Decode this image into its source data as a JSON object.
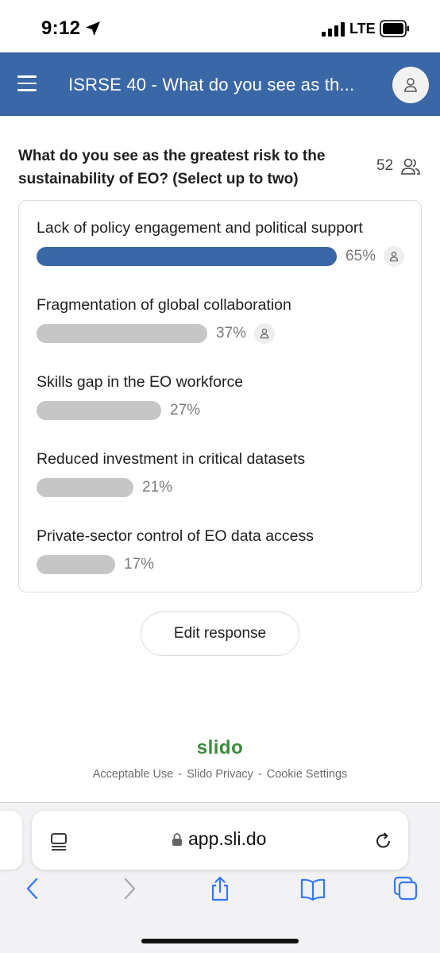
{
  "status_bar": {
    "time": "9:12",
    "network": "LTE"
  },
  "header": {
    "title": "ISRSE 40 - What do you see as th..."
  },
  "question": {
    "text": "What do you see as the greatest risk to the sustainability of EO? (Select up to two)",
    "participants": "52"
  },
  "options": [
    {
      "label": "Lack of policy engagement and political support",
      "percent_label": "65%",
      "percent": 65,
      "voted": true
    },
    {
      "label": "Fragmentation of global collaboration",
      "percent_label": "37%",
      "percent": 37,
      "voted": true
    },
    {
      "label": "Skills gap in the EO workforce",
      "percent_label": "27%",
      "percent": 27,
      "voted": false
    },
    {
      "label": "Reduced investment in critical datasets",
      "percent_label": "21%",
      "percent": 21,
      "voted": false
    },
    {
      "label": "Private-sector control of EO data access",
      "percent_label": "17%",
      "percent": 17,
      "voted": false
    }
  ],
  "edit_button": {
    "label": "Edit response"
  },
  "footer": {
    "logo": "slido",
    "links": [
      "Acceptable Use",
      "Slido Privacy",
      "Cookie Settings"
    ],
    "separator": "-"
  },
  "browser": {
    "url": "app.sli.do"
  },
  "colors": {
    "accent": "#3a67a6",
    "bar_gray": "#c6c6c6",
    "brand_green": "#3b8a3e"
  },
  "icons": [
    "location-arrow-icon",
    "signal-icon",
    "battery-icon",
    "menu-icon",
    "user-icon",
    "participants-icon",
    "tabs-icon",
    "lock-icon",
    "reload-icon",
    "back-icon",
    "forward-icon",
    "share-icon",
    "bookmarks-icon",
    "tab-overview-icon"
  ]
}
